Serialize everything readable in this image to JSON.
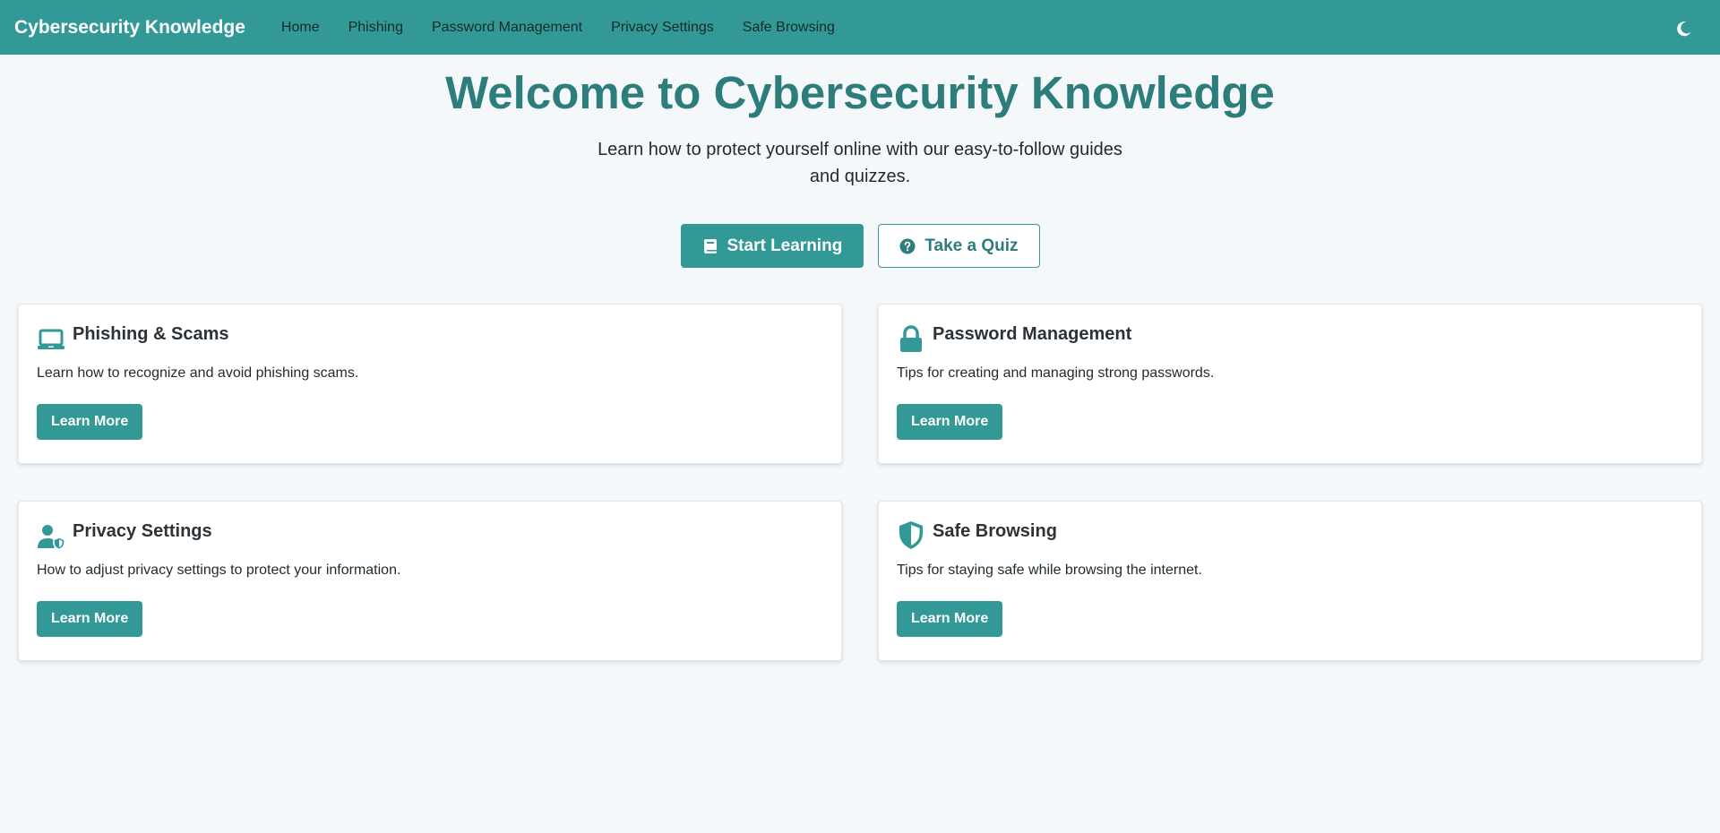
{
  "nav": {
    "brand": "Cybersecurity Knowledge",
    "links": [
      "Home",
      "Phishing",
      "Password Management",
      "Privacy Settings",
      "Safe Browsing"
    ],
    "theme_icon": "moon-icon"
  },
  "hero": {
    "title": "Welcome to Cybersecurity Knowledge",
    "subtitle": "Learn how to protect yourself online with our easy-to-follow guides and quizzes.",
    "primary_button": {
      "label": "Start Learning",
      "icon": "book-icon"
    },
    "secondary_button": {
      "label": "Take a Quiz",
      "icon": "question-circle-icon"
    }
  },
  "cards": [
    {
      "title": "Phishing & Scams",
      "description": "Learn how to recognize and avoid phishing scams.",
      "button": "Learn More",
      "icon": "laptop-icon"
    },
    {
      "title": "Password Management",
      "description": "Tips for creating and managing strong passwords.",
      "button": "Learn More",
      "icon": "lock-icon"
    },
    {
      "title": "Privacy Settings",
      "description": "How to adjust privacy settings to protect your information.",
      "button": "Learn More",
      "icon": "user-shield-icon"
    },
    {
      "title": "Safe Browsing",
      "description": "Tips for staying safe while browsing the internet.",
      "button": "Learn More",
      "icon": "shield-icon"
    }
  ],
  "colors": {
    "primary": "#329996",
    "primary_dark": "#2c7d7b",
    "background": "#f5f8fb"
  }
}
